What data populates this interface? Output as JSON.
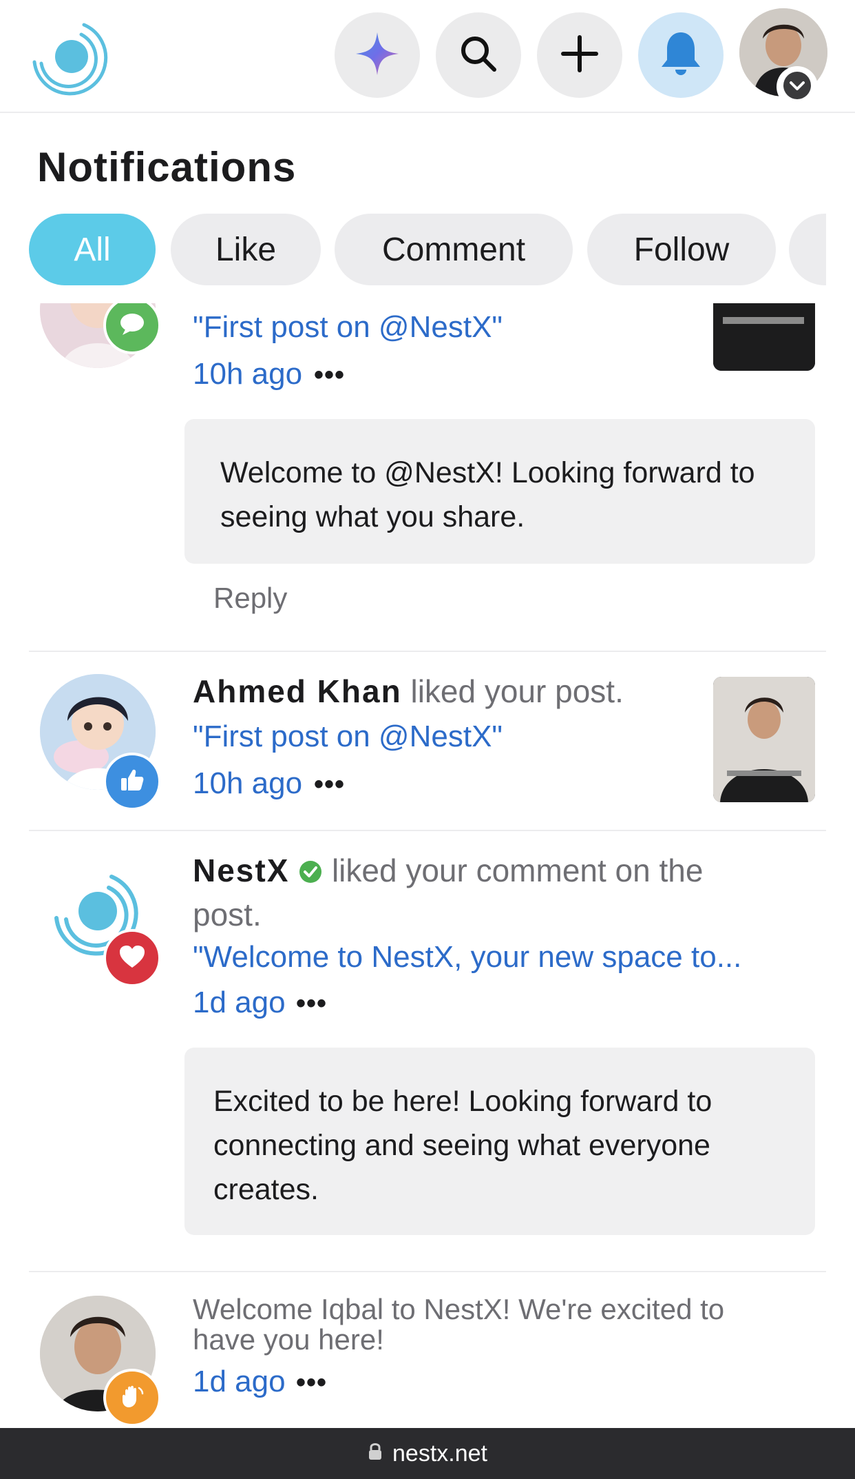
{
  "app": {
    "name": "NestX",
    "accent": "#5ccbe8",
    "link_color": "#2c6bc9"
  },
  "toolbar": {
    "buttons": [
      {
        "name": "ai-sparkle",
        "icon": "sparkle-icon"
      },
      {
        "name": "search",
        "icon": "search-icon"
      },
      {
        "name": "create",
        "icon": "plus-icon"
      },
      {
        "name": "notifications",
        "icon": "bell-icon",
        "active": true
      },
      {
        "name": "profile",
        "icon": "avatar"
      }
    ]
  },
  "page": {
    "title": "Notifications"
  },
  "tabs": [
    {
      "label": "All",
      "active": true
    },
    {
      "label": "Like"
    },
    {
      "label": "Comment"
    },
    {
      "label": "Follow"
    }
  ],
  "notifications": [
    {
      "type": "comment",
      "quote": "\"First post on @NestX\"",
      "time": "10h ago",
      "more": "•••",
      "comment_text": "Welcome to @NestX!  Looking forward to seeing what you share.",
      "reply_label": "Reply"
    },
    {
      "type": "like",
      "actor": "Ahmed Khan",
      "action": "liked your post.",
      "quote": "\"First post on @NestX\"",
      "time": "10h ago",
      "more": "•••"
    },
    {
      "type": "like-comment",
      "actor": "NestX",
      "verified": true,
      "action_line1": "liked your comment on the",
      "action_line2": "post.",
      "quote": "\"Welcome to NestX, your new space to...",
      "time": "1d ago",
      "more": "•••",
      "comment_text": "Excited to be here!  Looking forward to connecting and seeing what everyone creates."
    },
    {
      "type": "welcome",
      "message_line1": "Welcome Iqbal to NestX! We're excited to",
      "message_line2": "have you here!",
      "time": "1d ago",
      "more": "•••"
    }
  ],
  "browser": {
    "url": "nestx.net"
  }
}
